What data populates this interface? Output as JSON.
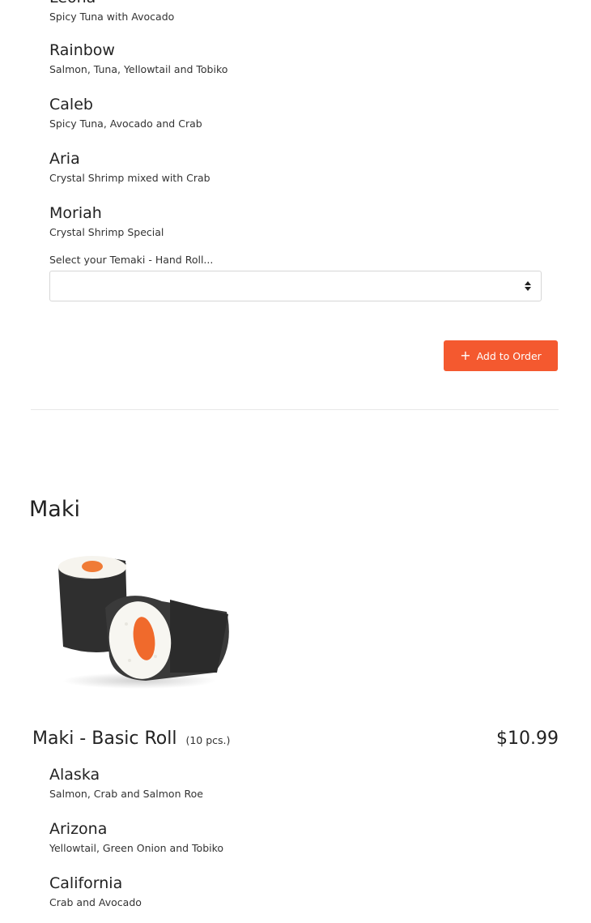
{
  "temaki_options": [
    {
      "name": "Leona",
      "desc": "Spicy Tuna with Avocado"
    },
    {
      "name": "Rainbow",
      "desc": "Salmon, Tuna, Yellowtail and Tobiko"
    },
    {
      "name": "Caleb",
      "desc": "Spicy Tuna, Avocado and Crab"
    },
    {
      "name": "Aria",
      "desc": "Crystal Shrimp mixed with Crab"
    },
    {
      "name": "Moriah",
      "desc": "Crystal Shrimp Special"
    }
  ],
  "temaki_select": {
    "label": "Select your Temaki - Hand Roll...",
    "value": ""
  },
  "add_to_order": {
    "label": "Add to Order",
    "icon": "plus-icon",
    "color": "#f4592f"
  },
  "maki_section": {
    "title": "Maki",
    "image_icon": "maki-roll-image",
    "item": {
      "name": "Maki - Basic Roll",
      "pieces": "(10 pcs.)",
      "price": "$10.99"
    },
    "options": [
      {
        "name": "Alaska",
        "desc": "Salmon, Crab and Salmon Roe"
      },
      {
        "name": "Arizona",
        "desc": "Yellowtail, Green Onion and Tobiko"
      },
      {
        "name": "California",
        "desc": "Crab and Avocado"
      }
    ]
  }
}
